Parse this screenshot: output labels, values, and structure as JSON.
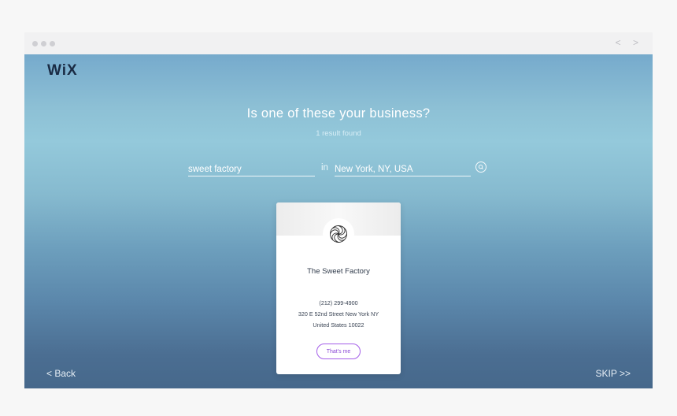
{
  "brand": {
    "logo_text": "WiX"
  },
  "browser": {
    "nav_arrows": "< >"
  },
  "search": {
    "headline": "Is one of these your business?",
    "results_count": "1 result found",
    "business_query": "sweet factory",
    "in_label": "in",
    "location_query": "New York, NY, USA"
  },
  "result": {
    "name": "The Sweet Factory",
    "phone": "(212) 299-4900",
    "address_line1": "320 E 52nd Street New York NY",
    "address_line2": "United States 10022",
    "confirm_label": "That's me"
  },
  "footer": {
    "back_label": "< Back",
    "skip_label": "SKIP >>"
  },
  "colors": {
    "accent": "#8b49d6",
    "logo": "#1a2b44"
  },
  "icons": {
    "search": "search-icon",
    "business_logo": "swirl-logo-icon"
  }
}
